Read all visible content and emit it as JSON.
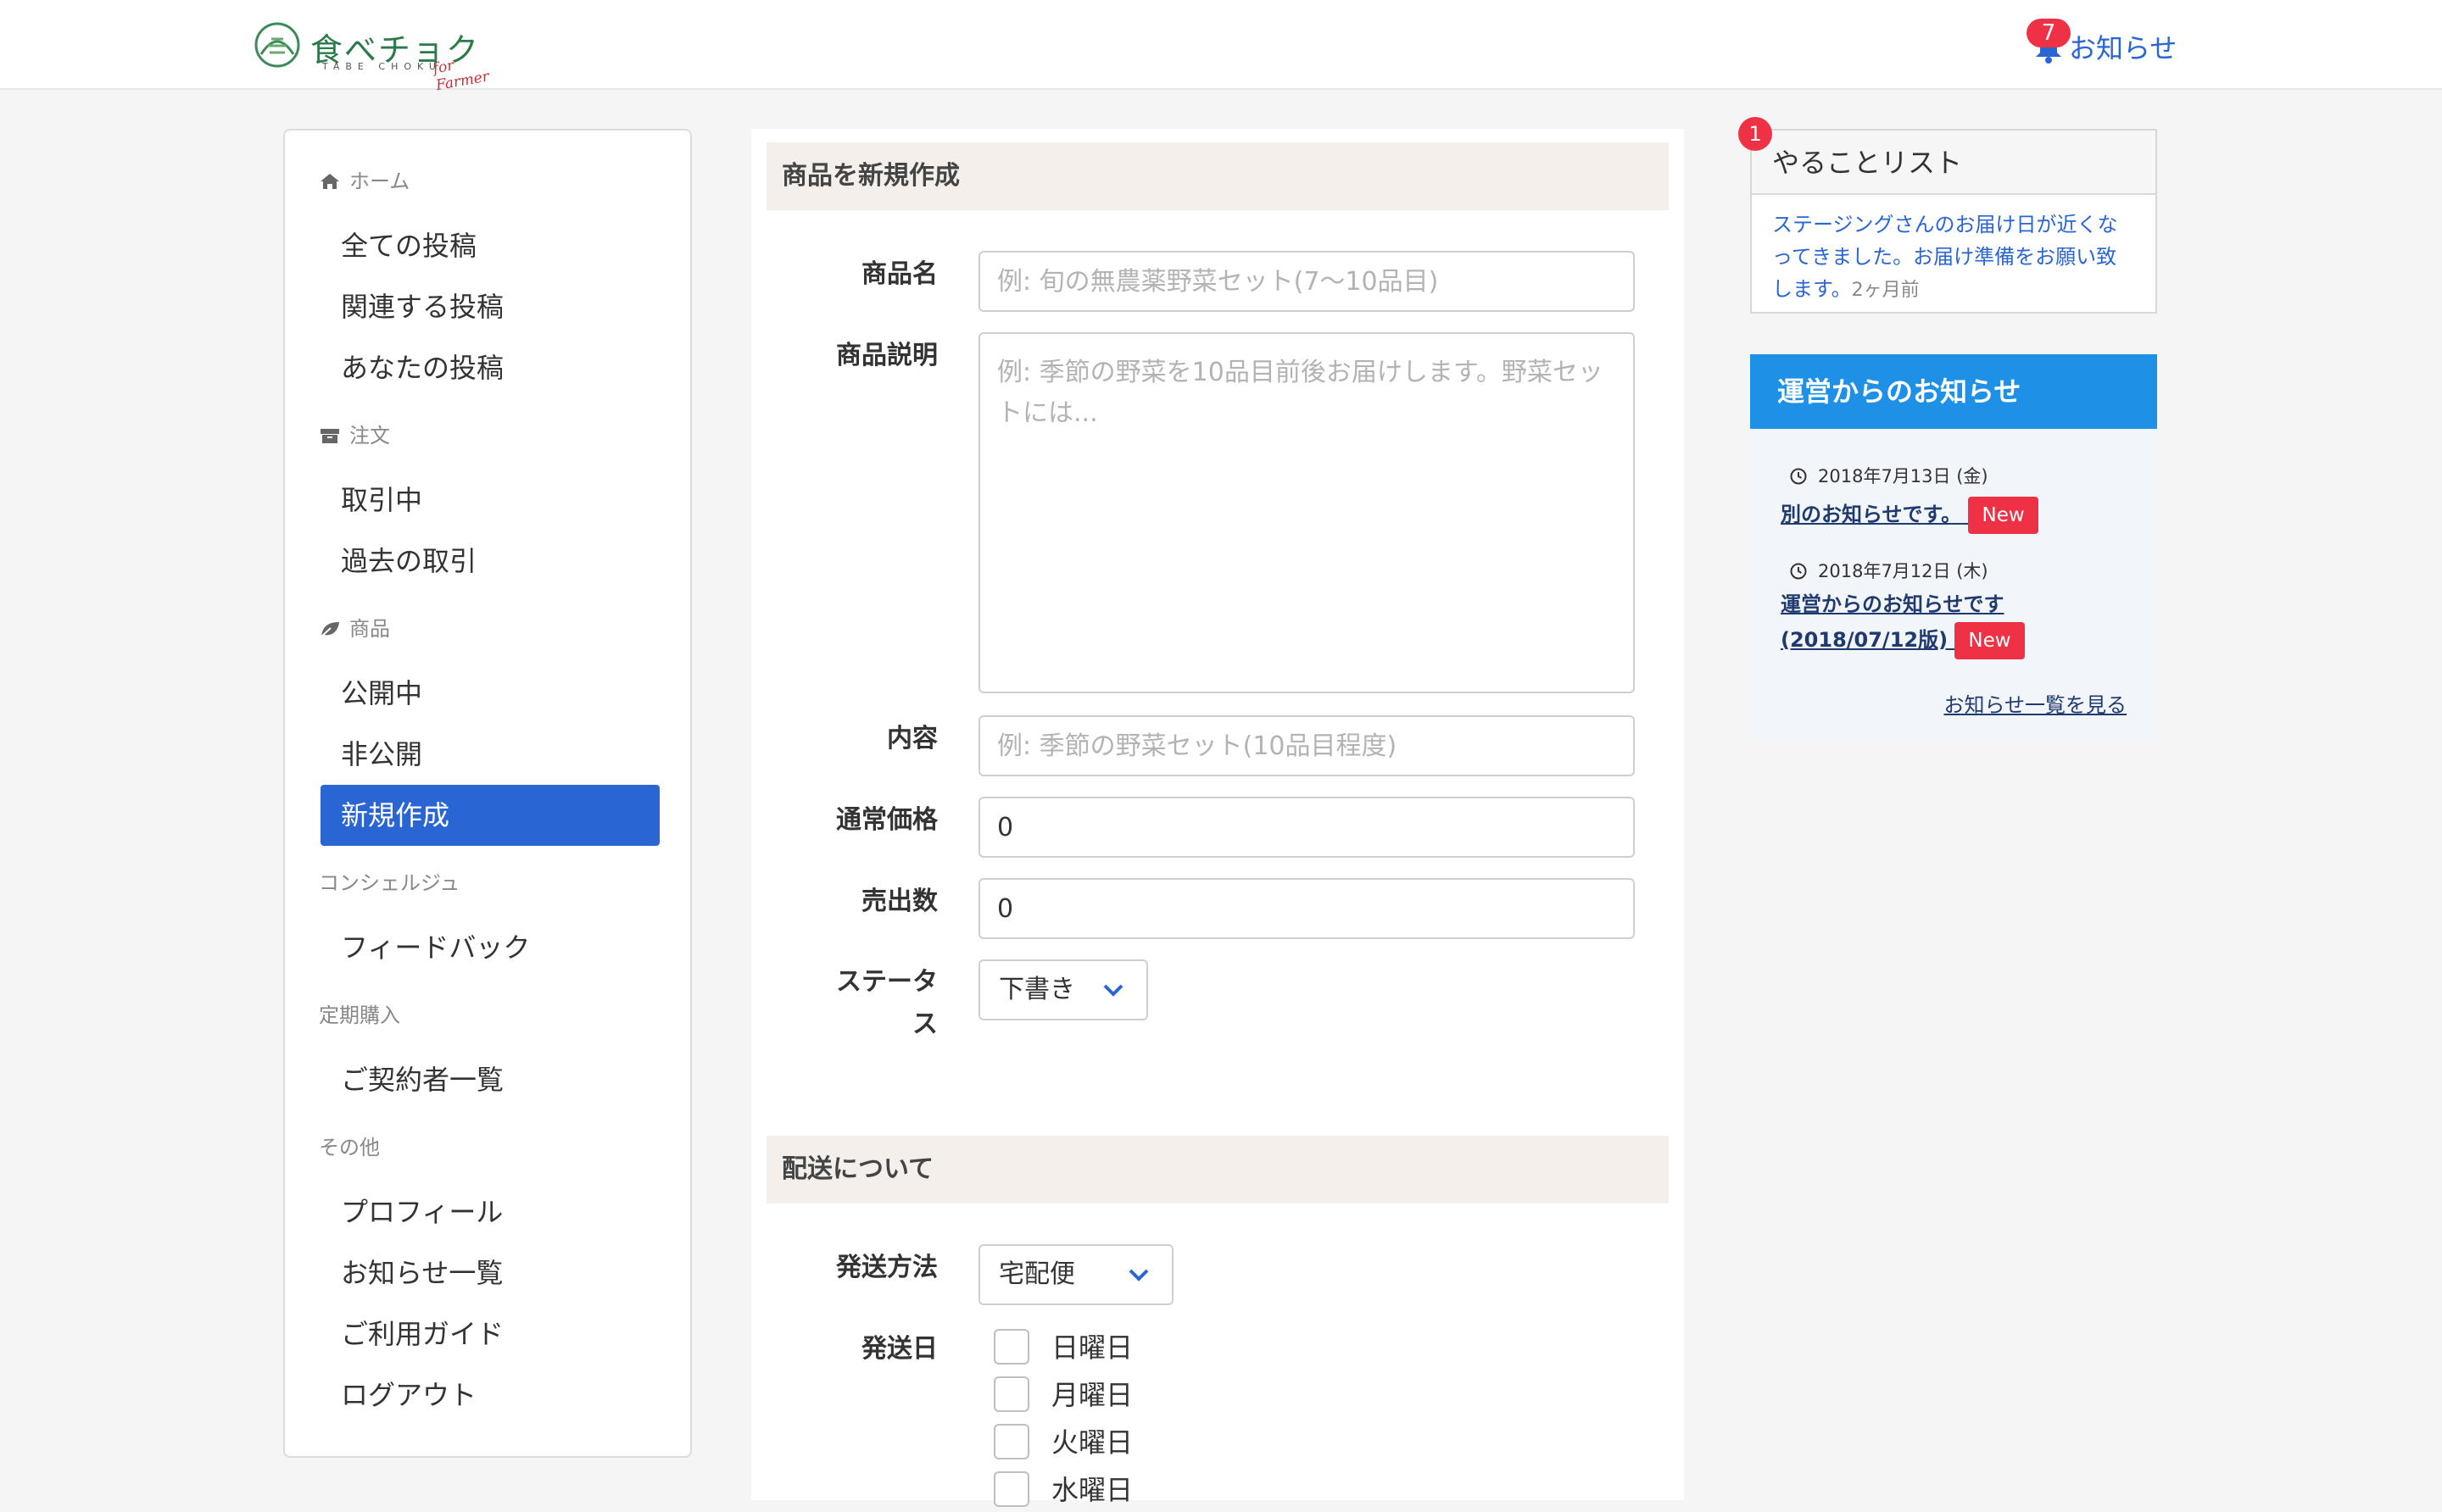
{
  "header": {
    "logo_jp": "食べチョク",
    "logo_en": "TABE CHOKU",
    "logo_script": "for Farmer",
    "notifications_count": "7",
    "notifications_label": "お知らせ"
  },
  "sidebar": {
    "sections": {
      "home": "ホーム",
      "order": "注文",
      "product": "商品",
      "concierge": "コンシェルジュ",
      "subscription": "定期購入",
      "other": "その他"
    },
    "items": {
      "all_posts": "全ての投稿",
      "related_posts": "関連する投稿",
      "your_posts": "あなたの投稿",
      "in_progress": "取引中",
      "past": "過去の取引",
      "published": "公開中",
      "unpublished": "非公開",
      "new": "新規作成",
      "feedback": "フィードバック",
      "contractors": "ご契約者一覧",
      "profile": "プロフィール",
      "notices": "お知らせ一覧",
      "guide": "ご利用ガイド",
      "logout": "ログアウト"
    }
  },
  "form": {
    "section_title": "商品を新規作成",
    "name_label": "商品名",
    "name_placeholder": "例: 旬の無農薬野菜セット(7〜10品目)",
    "desc_label": "商品説明",
    "desc_placeholder": "例: 季節の野菜を10品目前後お届けします。野菜セットには...",
    "content_label": "内容",
    "content_placeholder": "例: 季節の野菜セット(10品目程度)",
    "price_label": "通常価格",
    "price_value": "0",
    "sold_label": "売出数",
    "sold_value": "0",
    "status_label": "ステータス",
    "status_value": "下書き"
  },
  "shipping": {
    "section_title": "配送について",
    "method_label": "発送方法",
    "method_value": "宅配便",
    "day_label": "発送日",
    "days": [
      "日曜日",
      "月曜日",
      "火曜日",
      "水曜日"
    ]
  },
  "todo": {
    "title": "やることリスト",
    "badge": "1",
    "message": "ステージングさんのお届け日が近くなってきました。お届け準備をお願い致します。",
    "time": "2ヶ月前"
  },
  "news": {
    "title": "運営からのお知らせ",
    "items": [
      {
        "date": "2018年7月13日 (金)",
        "title": "別のお知らせです。",
        "tag": "New"
      },
      {
        "date": "2018年7月12日 (木)",
        "title": "運営からのお知らせです(2018/07/12版)",
        "tag": "New"
      }
    ],
    "more": "お知らせ一覧を見る"
  },
  "colors": {
    "accent": "#2a66d3",
    "badge": "#ef3145",
    "news_header": "#1e90e6",
    "section_bg": "#f4efea"
  }
}
